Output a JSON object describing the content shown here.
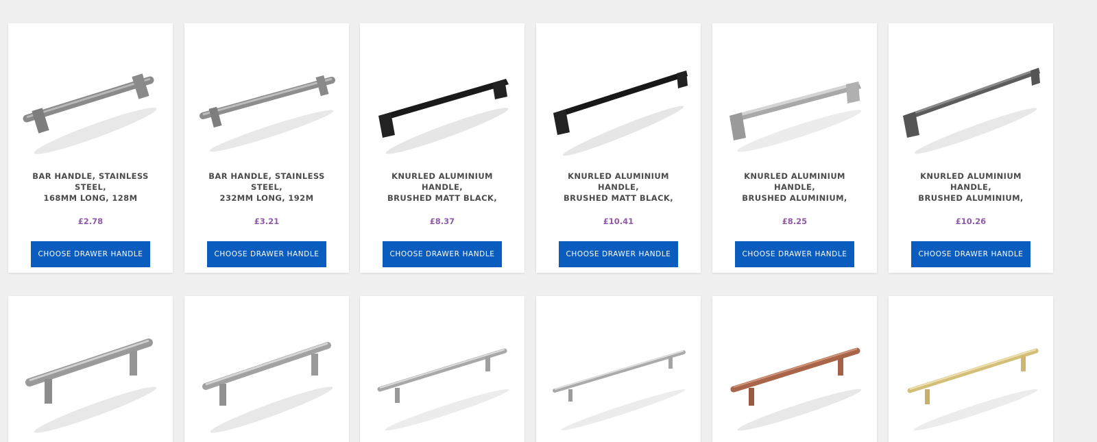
{
  "button_label": "CHOOSE DRAWER HANDLE",
  "colors": {
    "price": "#8e5aa6",
    "button_bg": "#0a5cbf",
    "title": "#4a4a4a",
    "page_bg": "#f0f0f0"
  },
  "products": [
    {
      "title_line1": "BAR HANDLE, STAINLESS STEEL,",
      "title_line2": "168MM LONG, 128M",
      "price": "£2.78",
      "icon": "stainless-bar-handle-icon"
    },
    {
      "title_line1": "BAR HANDLE, STAINLESS STEEL,",
      "title_line2": "232MM LONG, 192M",
      "price": "£3.21",
      "icon": "stainless-bar-handle-icon"
    },
    {
      "title_line1": "KNURLED ALUMINIUM HANDLE,",
      "title_line2": "BRUSHED MATT BLACK,",
      "price": "£8.37",
      "icon": "black-knurled-handle-icon"
    },
    {
      "title_line1": "KNURLED ALUMINIUM HANDLE,",
      "title_line2": "BRUSHED MATT BLACK,",
      "price": "£10.41",
      "icon": "black-knurled-handle-icon"
    },
    {
      "title_line1": "KNURLED ALUMINIUM HANDLE,",
      "title_line2": "BRUSHED ALUMINIUM,",
      "price": "£8.25",
      "icon": "aluminium-knurled-handle-icon"
    },
    {
      "title_line1": "KNURLED ALUMINIUM HANDLE,",
      "title_line2": "BRUSHED ALUMINIUM,",
      "price": "£10.26",
      "icon": "aluminium-knurled-handle-icon"
    }
  ],
  "row2_products": [
    {
      "icon": "steel-t-bar-handle-icon"
    },
    {
      "icon": "steel-t-bar-handle-icon"
    },
    {
      "icon": "steel-t-bar-handle-icon"
    },
    {
      "icon": "steel-t-bar-handle-icon"
    },
    {
      "icon": "copper-t-bar-handle-icon"
    },
    {
      "icon": "brass-t-bar-handle-icon"
    }
  ]
}
